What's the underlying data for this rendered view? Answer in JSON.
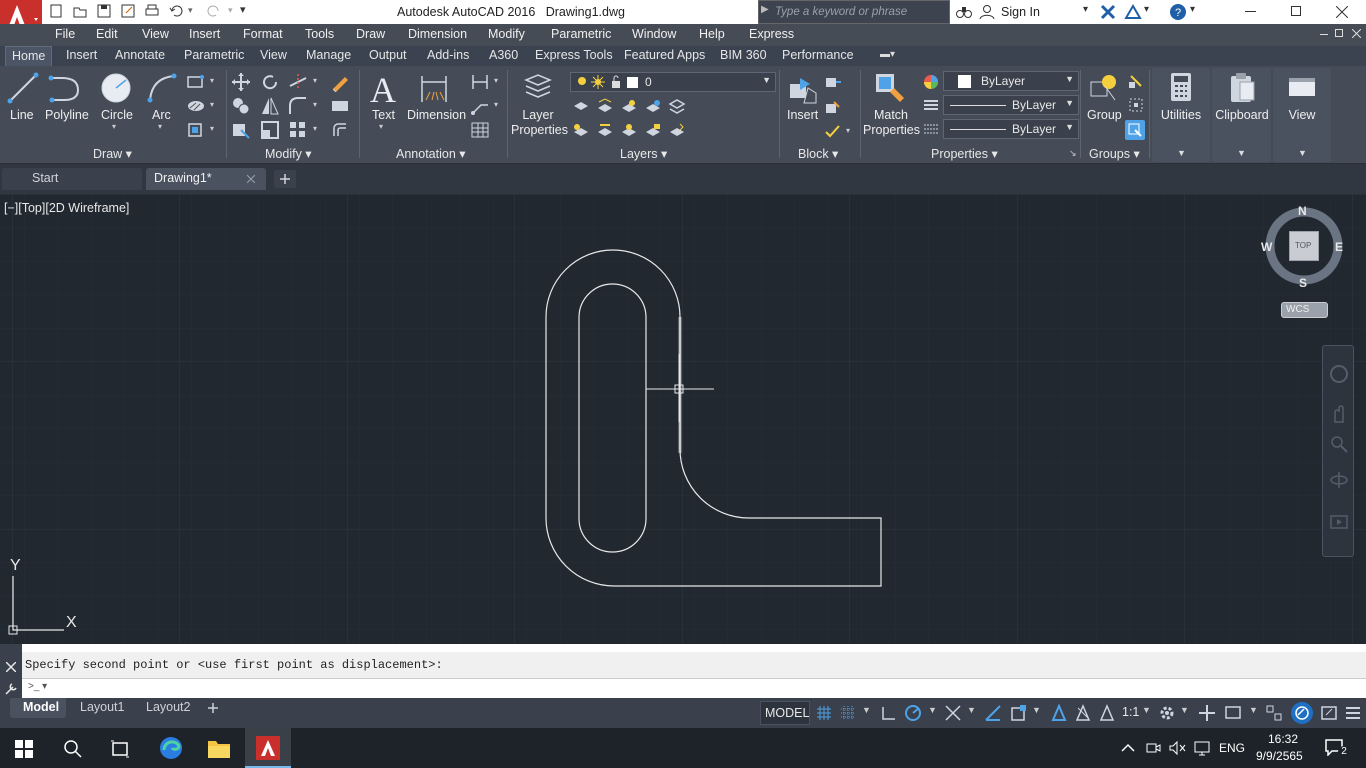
{
  "title": {
    "app": "Autodesk AutoCAD 2016",
    "file": "Drawing1.dwg",
    "search_placeholder": "Type a keyword or phrase",
    "sign_in": "Sign In"
  },
  "menubar": [
    "File",
    "Edit",
    "View",
    "Insert",
    "Format",
    "Tools",
    "Draw",
    "Dimension",
    "Modify",
    "Parametric",
    "Window",
    "Help",
    "Express"
  ],
  "ribbon_tabs": [
    "Home",
    "Insert",
    "Annotate",
    "Parametric",
    "View",
    "Manage",
    "Output",
    "Add-ins",
    "A360",
    "Express Tools",
    "Featured Apps",
    "BIM 360",
    "Performance"
  ],
  "ribbon": {
    "draw": {
      "line": "Line",
      "polyline": "Polyline",
      "circle": "Circle",
      "arc": "Arc",
      "title": "Draw"
    },
    "modify": {
      "title": "Modify"
    },
    "annotation": {
      "text": "Text",
      "dimension": "Dimension",
      "title": "Annotation"
    },
    "layers": {
      "layer_properties_1": "Layer",
      "layer_properties_2": "Properties",
      "current_layer": "0",
      "title": "Layers"
    },
    "block": {
      "insert": "Insert",
      "title": "Block"
    },
    "properties": {
      "match_1": "Match",
      "match_2": "Properties",
      "color": "ByLayer",
      "linetype": "ByLayer",
      "lineweight": "ByLayer",
      "title": "Properties"
    },
    "groups": {
      "group": "Group",
      "title": "Groups"
    },
    "utilities": "Utilities",
    "clipboard": "Clipboard",
    "view": "View"
  },
  "file_tabs": {
    "start": "Start",
    "drawing": "Drawing1*"
  },
  "viewport": {
    "label": "[−][Top][2D Wireframe]",
    "compass": {
      "n": "N",
      "s": "S",
      "e": "E",
      "w": "W",
      "top": "TOP",
      "wcs": "WCS"
    },
    "ucs": {
      "x": "X",
      "y": "Y"
    }
  },
  "command": {
    "prompt": "Specify second point or <use first point as displacement>:",
    "input": ""
  },
  "layout_tabs": [
    "Model",
    "Layout1",
    "Layout2"
  ],
  "status": {
    "model": "MODEL",
    "scale": "1:1"
  },
  "taskbar": {
    "lang": "ENG",
    "time": "16:32",
    "date": "9/9/2565",
    "notif": "2"
  }
}
